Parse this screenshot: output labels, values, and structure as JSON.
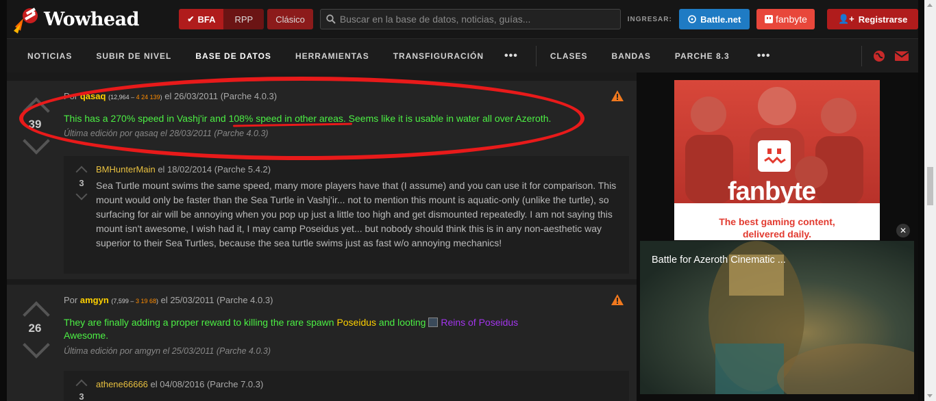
{
  "header": {
    "logo_text": "Wowhead",
    "versions": [
      "BFA",
      "RPP",
      "Clásico"
    ],
    "search_placeholder": "Buscar en la base de datos, noticias, guías...",
    "login_label": "INGRESAR:",
    "battlenet_label": "Battle.net",
    "fanbyte_label": "fanbyte",
    "register_label": "Registrarse"
  },
  "nav": {
    "items": [
      "NOTICIAS",
      "SUBIR DE NIVEL",
      "BASE DE DATOS",
      "HERRAMIENTAS",
      "TRANSFIGURACIÓN",
      "CLASES",
      "BANDAS",
      "PARCHE 8.3"
    ],
    "more": "•••"
  },
  "comments": [
    {
      "by": "Por",
      "user": "qasaq",
      "rep": "12,964",
      "badges": "4 24 139",
      "date": "el 26/03/2011 (Parche 4.0.3)",
      "score": "39",
      "body_a": "This has a 270% speed in Vashj'ir and ",
      "body_b": "108% speed in other areas",
      "body_c": ". Seems like it is usable in water all over Azeroth.",
      "edited": "Última edición por qasaq el 28/03/2011 (Parche 4.0.3)"
    },
    {
      "by": "Por",
      "user": "amgyn",
      "rep": "7,599",
      "badges": "3 19 68",
      "date": "el 25/03/2011 (Parche 4.0.3)",
      "score": "26",
      "body_a": "They are finally adding a proper reward to killing the rare spawn ",
      "link1": "Poseidus",
      "body_b": " and looting ",
      "link2": "Reins of Poseidus",
      "body_c": "Awesome.",
      "edited": "Última edición por amgyn el 25/03/2011 (Parche 4.0.3)"
    }
  ],
  "replies": [
    {
      "user": "BMHunterMain",
      "date": "el 18/02/2014 (Parche 5.4.2)",
      "score": "3",
      "text": "Sea Turtle mount swims the same speed, many more players have that (I assume) and you can use it for comparison. This mount would only be faster than the Sea Turtle in Vashj'ir... not to mention this mount is aquatic-only (unlike the turtle), so surfacing for air will be annoying when you pop up just a little too high and get dismounted repeatedly. I am not saying this mount isn't awesome, I wish had it, I may camp Poseidus yet... but nobody should think this is in any non-aesthetic way superior to their Sea Turtles, because the sea turtle swims just as fast w/o annoying mechanics!"
    },
    {
      "user": "athene66666",
      "date": "el 04/08/2016 (Parche 7.0.3)",
      "score": "3"
    }
  ],
  "ad": {
    "brand": "fanbyte",
    "tagline_1": "The best gaming content,",
    "tagline_2": "delivered daily."
  },
  "video": {
    "title": "Battle for Azeroth Cinematic ...",
    "close": "✕"
  }
}
